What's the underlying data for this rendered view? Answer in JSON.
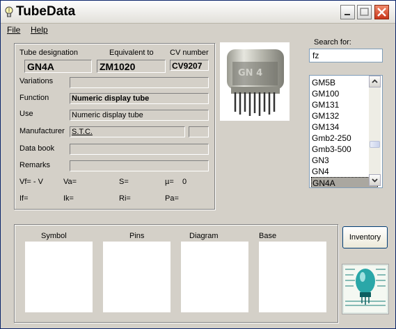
{
  "window": {
    "title": "TubeData"
  },
  "menu": {
    "file": "File",
    "help": "Help"
  },
  "details": {
    "designation_label": "Tube designation",
    "designation": "GN4A",
    "equivalent_label": "Equivalent to",
    "equivalent": "ZM1020",
    "cv_label": "CV number",
    "cv": "CV9207",
    "variations_label": "Variations",
    "variations": "",
    "function_label": "Function",
    "function": "Numeric display tube",
    "use_label": "Use",
    "use": "Numeric display tube",
    "manufacturer_label": "Manufacturer",
    "manufacturer": "S.T.C.",
    "manufacturer_extra": "",
    "databook_label": "Data book",
    "databook": "",
    "remarks_label": "Remarks",
    "remarks": ""
  },
  "params": {
    "vf": "Vf= - V",
    "va": "Va=",
    "s": "S=",
    "mu": "µ=    0",
    "if": "If=",
    "ik": "Ik=",
    "ri": "Ri=",
    "pa": "Pa="
  },
  "search": {
    "label": "Search for:",
    "value": "fz"
  },
  "tube_list": {
    "items": [
      "GM5B",
      "GM100",
      "GM131",
      "GM132",
      "GM134",
      "Gmb2-250",
      "Gmb3-500",
      "GN3",
      "GN4",
      "GN4A"
    ],
    "selected": "GN4A"
  },
  "bottom": {
    "symbol": "Symbol",
    "pins": "Pins",
    "diagram": "Diagram",
    "base": "Base",
    "inventory_button": "Inventory"
  },
  "photo_text": "GN 4",
  "colors": {
    "titlebar": "#f0efea",
    "window_bg": "#d4d0c8",
    "close": "#d9462a",
    "selection": "#aaa7a0"
  }
}
